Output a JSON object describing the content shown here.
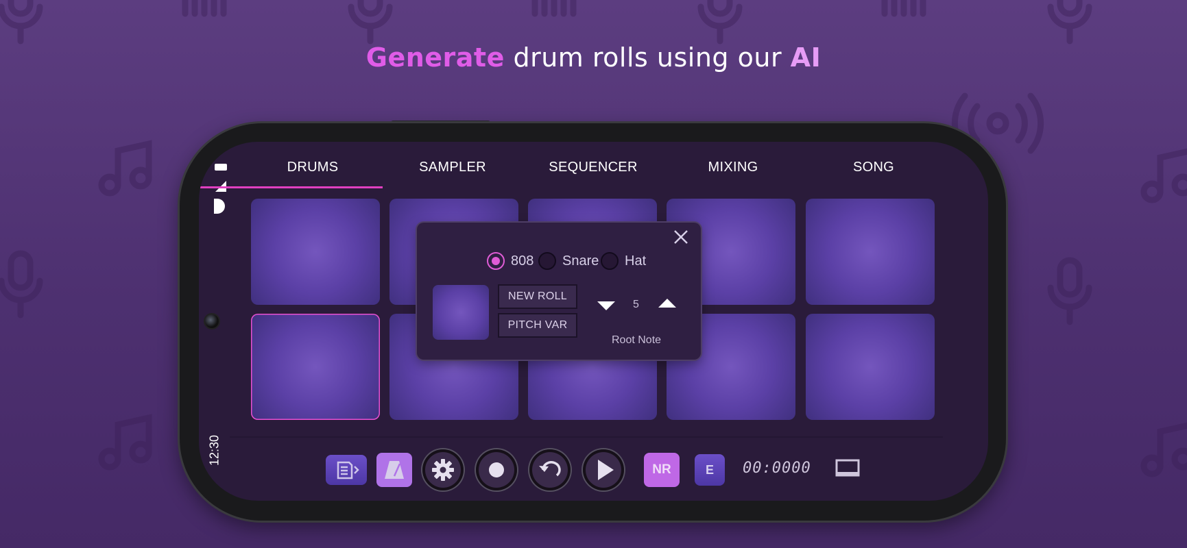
{
  "headline": {
    "part1": "Generate",
    "part2": " drum rolls using our ",
    "part3": "AI"
  },
  "colors": {
    "accent": "#e05ce8",
    "pad": "#5b40a6",
    "background": "#4d3070"
  },
  "status_bar": {
    "time": "12:30"
  },
  "tabs": [
    {
      "label": "DRUMS",
      "active": true
    },
    {
      "label": "SAMPLER",
      "active": false
    },
    {
      "label": "SEQUENCER",
      "active": false
    },
    {
      "label": "MIXING",
      "active": false
    },
    {
      "label": "SONG",
      "active": false
    }
  ],
  "dialog": {
    "options": [
      {
        "label": "808",
        "selected": true
      },
      {
        "label": "Snare",
        "selected": false
      },
      {
        "label": "Hat",
        "selected": false
      }
    ],
    "new_roll": "NEW ROLL",
    "pitch_var": "PITCH VAR",
    "root_note_value": "5",
    "root_note_label": "Root Note"
  },
  "toolbar": {
    "nr_label": "NR",
    "e_label": "E",
    "timer": "00:0000"
  },
  "icons": [
    "sequence-list-icon",
    "metronome-icon",
    "settings-gear-icon",
    "record-icon",
    "undo-icon",
    "play-icon",
    "screen-icon",
    "close-icon"
  ]
}
